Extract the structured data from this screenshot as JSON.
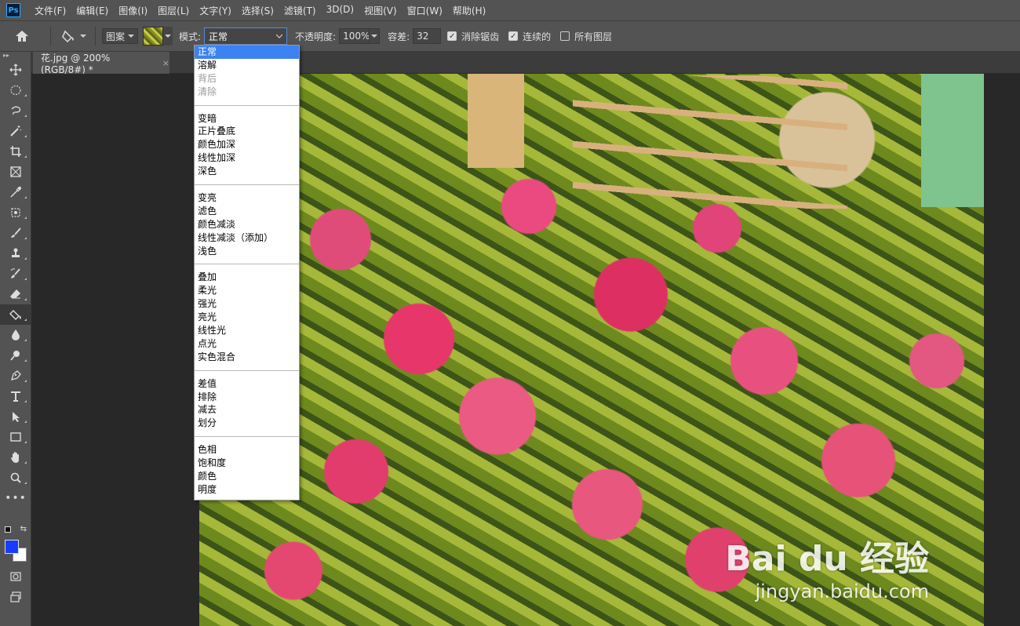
{
  "menubar": {
    "logo": "Ps",
    "items": [
      "文件(F)",
      "编辑(E)",
      "图像(I)",
      "图层(L)",
      "文字(Y)",
      "选择(S)",
      "滤镜(T)",
      "3D(D)",
      "视图(V)",
      "窗口(W)",
      "帮助(H)"
    ]
  },
  "options": {
    "fill_source": "图案",
    "mode_label": "模式:",
    "mode_value": "正常",
    "opacity_label": "不透明度:",
    "opacity_value": "100%",
    "tolerance_label": "容差:",
    "tolerance_value": "32",
    "antialias_label": "消除锯齿",
    "antialias_checked": true,
    "contiguous_label": "连续的",
    "contiguous_checked": true,
    "all_layers_label": "所有图层",
    "all_layers_checked": false
  },
  "document": {
    "tab_title": "花.jpg @ 200%(RGB/8#) *",
    "close_glyph": "×"
  },
  "toolbar": {
    "tools": [
      "move-tool",
      "ellipse-marquee-tool",
      "lasso-tool",
      "magic-wand-tool",
      "crop-tool",
      "frame-tool",
      "eyedropper-tool",
      "healing-brush-tool",
      "brush-tool",
      "clone-stamp-tool",
      "history-brush-tool",
      "eraser-tool",
      "paint-bucket-tool",
      "blur-tool",
      "dodge-tool",
      "pen-tool",
      "type-tool",
      "path-selection-tool",
      "rectangle-tool",
      "hand-tool",
      "zoom-tool",
      "more-tools"
    ],
    "active_tool": "paint-bucket-tool",
    "foreground_color": "#1a3cff",
    "background_color": "#ffffff"
  },
  "blend_modes": {
    "groups": [
      [
        "正常",
        "溶解",
        "背后",
        "清除"
      ],
      [
        "变暗",
        "正片叠底",
        "颜色加深",
        "线性加深",
        "深色"
      ],
      [
        "变亮",
        "滤色",
        "颜色减淡",
        "线性减淡（添加）",
        "浅色"
      ],
      [
        "叠加",
        "柔光",
        "强光",
        "亮光",
        "线性光",
        "点光",
        "实色混合"
      ],
      [
        "差值",
        "排除",
        "减去",
        "划分"
      ],
      [
        "色相",
        "饱和度",
        "颜色",
        "明度"
      ]
    ],
    "selected": "正常",
    "disabled": [
      "背后",
      "清除"
    ]
  },
  "watermark": {
    "main": "Bai du 经验",
    "sub": "jingyan.baidu.com"
  }
}
